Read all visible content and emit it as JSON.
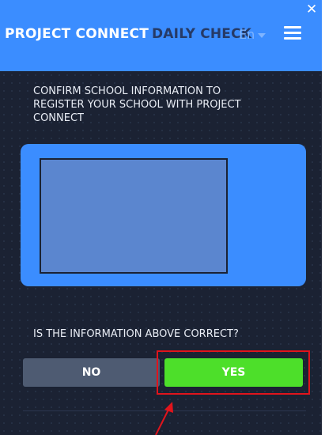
{
  "header": {
    "brand_primary": "PROJECT CONNECT",
    "brand_secondary": "DAILY CHECK",
    "language": "En",
    "menu_icon": "hamburger-menu-icon",
    "close_icon": "close-icon",
    "close_glyph": "✕"
  },
  "main": {
    "confirm_message": "CONFIRM SCHOOL INFORMATION TO REGISTER YOUR SCHOOL WITH PROJECT CONNECT",
    "question": "IS THE INFORMATION ABOVE CORRECT?",
    "no_label": "NO",
    "yes_label": "YES"
  },
  "colors": {
    "background": "#1b2233",
    "header": "#3b8dff",
    "brand_secondary": "#263a66",
    "no_button": "#4e5b72",
    "yes_button": "#4ddf2a",
    "highlight": "#e0141c"
  }
}
